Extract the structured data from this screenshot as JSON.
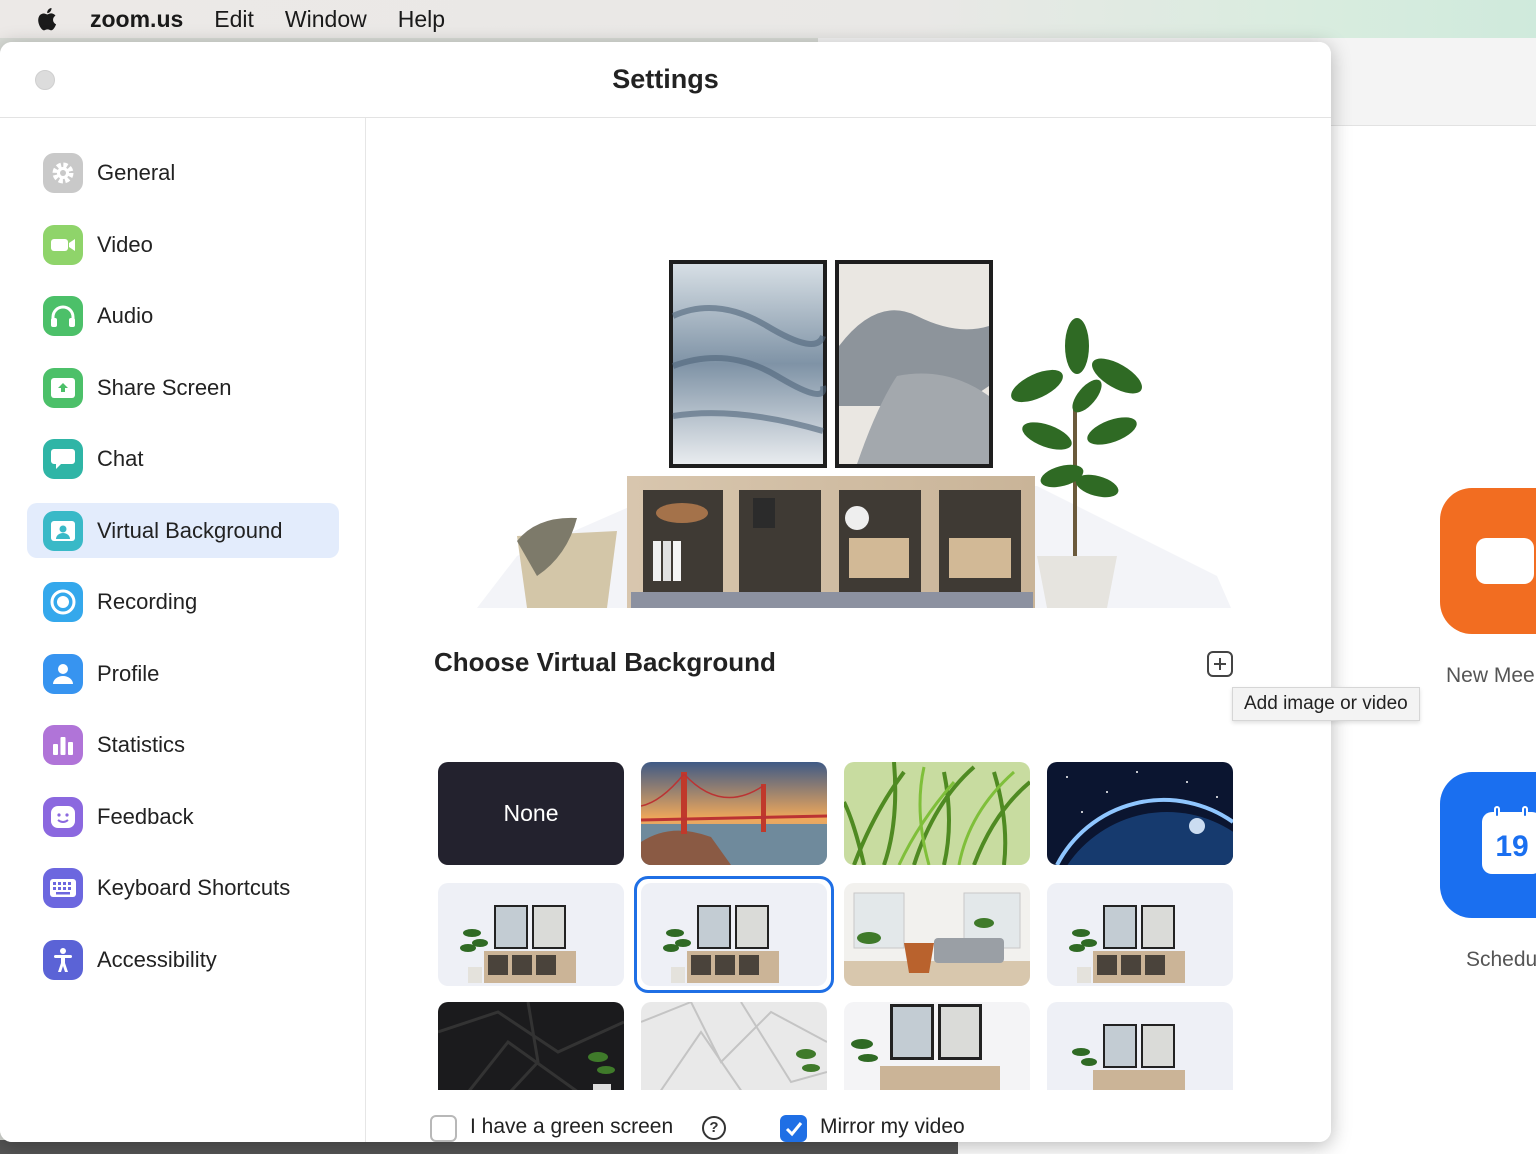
{
  "menubar": {
    "app": "zoom.us",
    "items": [
      "Edit",
      "Window",
      "Help"
    ]
  },
  "window": {
    "title": "Settings"
  },
  "sidebar": {
    "items": [
      {
        "label": "General",
        "icon": "gear-icon",
        "color": "#c9c9c9"
      },
      {
        "label": "Video",
        "icon": "video-camera-icon",
        "color": "#8fd46a"
      },
      {
        "label": "Audio",
        "icon": "headphones-icon",
        "color": "#4cc069"
      },
      {
        "label": "Share Screen",
        "icon": "share-screen-icon",
        "color": "#4cc069"
      },
      {
        "label": "Chat",
        "icon": "chat-bubble-icon",
        "color": "#2fb5a6"
      },
      {
        "label": "Virtual Background",
        "icon": "virtual-background-icon",
        "color": "#39b9c7"
      },
      {
        "label": "Recording",
        "icon": "record-icon",
        "color": "#34a8ec"
      },
      {
        "label": "Profile",
        "icon": "person-icon",
        "color": "#3794f0"
      },
      {
        "label": "Statistics",
        "icon": "bar-chart-icon",
        "color": "#b074d8"
      },
      {
        "label": "Feedback",
        "icon": "smiley-icon",
        "color": "#8b68df"
      },
      {
        "label": "Keyboard Shortcuts",
        "icon": "keyboard-icon",
        "color": "#6c67df"
      },
      {
        "label": "Accessibility",
        "icon": "accessibility-icon",
        "color": "#5b63d6"
      }
    ],
    "active_index": 5
  },
  "main": {
    "section_title": "Choose Virtual Background",
    "add_tooltip": "Add image or video",
    "thumbnails": [
      {
        "label": "None",
        "kind": "none"
      },
      {
        "kind": "golden-gate-bridge"
      },
      {
        "kind": "grass"
      },
      {
        "kind": "earth-from-space"
      },
      {
        "kind": "shelf-room"
      },
      {
        "kind": "shelf-room",
        "selected": true
      },
      {
        "kind": "living-room"
      },
      {
        "kind": "shelf-room"
      },
      {
        "kind": "dark-geometric"
      },
      {
        "kind": "white-geometric"
      },
      {
        "kind": "shelf-room-close"
      },
      {
        "kind": "shelf-room"
      }
    ],
    "green_screen_label": "I have a green screen",
    "green_screen_checked": false,
    "mirror_label": "Mirror my video",
    "mirror_checked": true
  },
  "background_window": {
    "new_meeting_label": "New Mee",
    "schedule_label": "Schedu",
    "calendar_day": "19",
    "accent_orange": "#f26d21",
    "accent_blue": "#1a6ff0"
  }
}
